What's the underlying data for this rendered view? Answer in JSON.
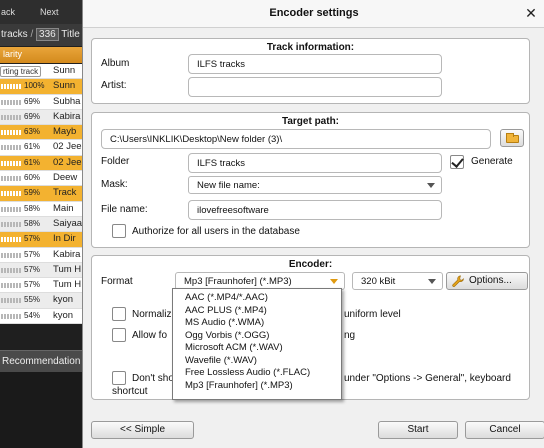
{
  "background_app": {
    "nav_back": "ack",
    "nav_next": "Next",
    "bar_text": "tracks",
    "bar_sep": " / ",
    "bar_count": "336",
    "bar_title": " Title",
    "column_header": "larity",
    "rows": [
      {
        "pct": "",
        "title": "Sunn",
        "style": "w",
        "badge": "rting track"
      },
      {
        "pct": "100%",
        "title": "Sunn",
        "style": "o",
        "badge": ""
      },
      {
        "pct": "69%",
        "title": "Subha",
        "style": "w",
        "badge": ""
      },
      {
        "pct": "69%",
        "title": "Kabira",
        "style": "g",
        "badge": ""
      },
      {
        "pct": "63%",
        "title": "Mayb",
        "style": "o",
        "badge": ""
      },
      {
        "pct": "61%",
        "title": "02 Jee",
        "style": "w",
        "badge": ""
      },
      {
        "pct": "61%",
        "title": "02 Jee",
        "style": "o",
        "badge": ""
      },
      {
        "pct": "60%",
        "title": "Deew",
        "style": "w",
        "badge": ""
      },
      {
        "pct": "59%",
        "title": "Track",
        "style": "o",
        "badge": ""
      },
      {
        "pct": "58%",
        "title": "Main",
        "style": "w",
        "badge": ""
      },
      {
        "pct": "58%",
        "title": "Saiyaa",
        "style": "g",
        "badge": ""
      },
      {
        "pct": "57%",
        "title": "In Dir",
        "style": "o",
        "badge": ""
      },
      {
        "pct": "57%",
        "title": "Kabira",
        "style": "w",
        "badge": ""
      },
      {
        "pct": "57%",
        "title": "Tum H",
        "style": "g",
        "badge": ""
      },
      {
        "pct": "57%",
        "title": "Tum H",
        "style": "w",
        "badge": ""
      },
      {
        "pct": "55%",
        "title": "kyon",
        "style": "g",
        "badge": ""
      },
      {
        "pct": "54%",
        "title": "kyon",
        "style": "w",
        "badge": ""
      }
    ],
    "recommendations_tab": "Recommendation"
  },
  "dialog": {
    "title": "Encoder settings",
    "track_info": {
      "title": "Track information:",
      "album_label": "Album",
      "album_value": "ILFS tracks",
      "artist_label": "Artist:",
      "artist_value": ""
    },
    "target_path": {
      "title": "Target path:",
      "path_value": "C:\\Users\\INKLIK\\Desktop\\New folder (3)\\",
      "folder_label": "Folder",
      "folder_value": "ILFS tracks",
      "generate_label": "Generate",
      "generate_checked": true,
      "mask_label": "Mask:",
      "mask_value": "New file name:",
      "filename_label": "File name:",
      "filename_value": "ilovefreesoftware",
      "authorize_label": "Authorize for all users in the database",
      "authorize_checked": false
    },
    "encoder": {
      "title": "Encoder:",
      "format_label": "Format",
      "format_value": "Mp3 [Fraunhofer] (*.MP3)",
      "bitrate_value": "320 kBit",
      "options_label": "Options...",
      "normalize_label_left": "Normaliz",
      "normalize_label_right": "uniform level",
      "allow_label_left": "Allow fo",
      "allow_label_right": "ng",
      "dont_show_line1_left": "Don't sho",
      "dont_show_line1_right": "under \"Options -> General\", keyboard",
      "dont_show_line2_left": "shortcut",
      "format_options": [
        "AAC (*.MP4/*.AAC)",
        "AAC PLUS (*.MP4)",
        "MS Audio (*.WMA)",
        "Ogg Vorbis (*.OGG)",
        "Microsoft ACM (*.WAV)",
        "Wavefile (*.WAV)",
        "Free Lossless Audio (*.FLAC)",
        "Mp3 [Fraunhofer] (*.MP3)"
      ]
    },
    "buttons": {
      "simple": "<< Simple",
      "start": "Start",
      "cancel": "Cancel"
    }
  }
}
